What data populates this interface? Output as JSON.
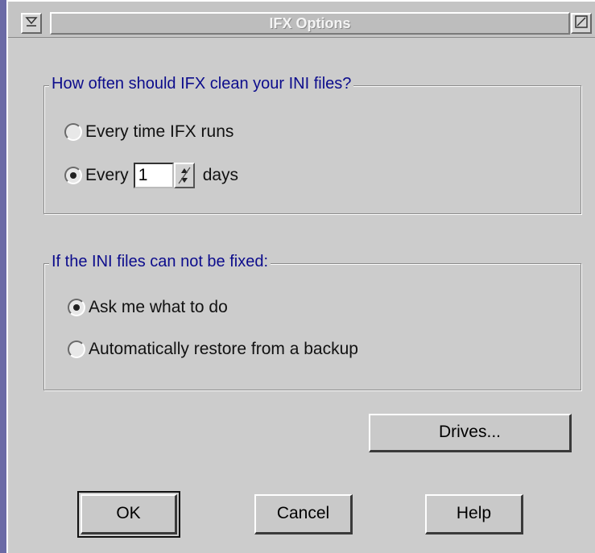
{
  "window": {
    "title": "IFX Options",
    "system_menu_icon": "system-menu-icon",
    "maximize_icon": "maximize-icon"
  },
  "clean_group": {
    "legend": "How often should IFX clean your INI files?",
    "option_every_run": "Every time IFX runs",
    "option_every_n_prefix": "Every",
    "days_value": "1",
    "days_suffix": "days",
    "selected": "every_n_days"
  },
  "fix_group": {
    "legend": "If the INI files can not be fixed:",
    "option_ask": "Ask me what to do",
    "option_restore": "Automatically restore from a backup",
    "selected": "ask"
  },
  "buttons": {
    "drives": "Drives...",
    "ok": "OK",
    "cancel": "Cancel",
    "help": "Help"
  }
}
